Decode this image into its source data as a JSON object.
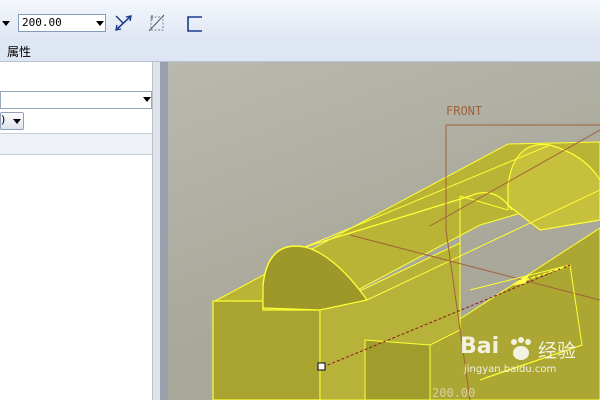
{
  "toolbar": {
    "depth_value": "200.00",
    "tools": [
      "flip-depth-icon",
      "thicken-icon",
      "sketch-plane-icon"
    ]
  },
  "tabs": [
    {
      "label": "属性"
    }
  ],
  "viewport": {
    "datum_label": "FRONT",
    "dimension_label": "200.00"
  },
  "watermark": {
    "brand": "Bai",
    "suffix": "经验",
    "url": "jingyan.baidu.com"
  },
  "colors": {
    "model_fill": "#c9c23a",
    "model_edge": "#ffff33",
    "datum_color": "#a0623a",
    "toolbar_bg": "#dfe6f3"
  }
}
